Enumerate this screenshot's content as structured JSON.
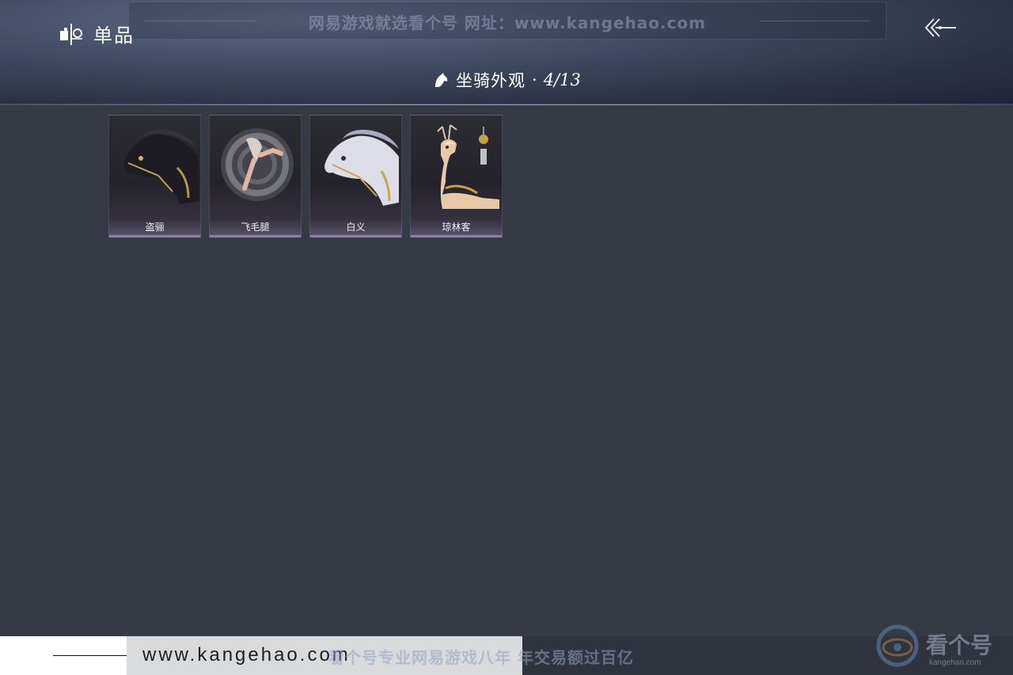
{
  "header": {
    "section_label": "单品",
    "watermark": "网易游戏就选看个号  网址：www.kangehao.com",
    "title": "坐骑外观",
    "separator": "·",
    "count": "4/13"
  },
  "items": [
    {
      "name": "盗骊"
    },
    {
      "name": "飞毛腿"
    },
    {
      "name": "白义"
    },
    {
      "name": "琼林客"
    }
  ],
  "footer": {
    "url": "www.kangehao.com",
    "watermark": "看个号专业网易游戏八年  年交易额过百亿",
    "logo_text": "看个号",
    "logo_sub": "kangehao.com"
  }
}
